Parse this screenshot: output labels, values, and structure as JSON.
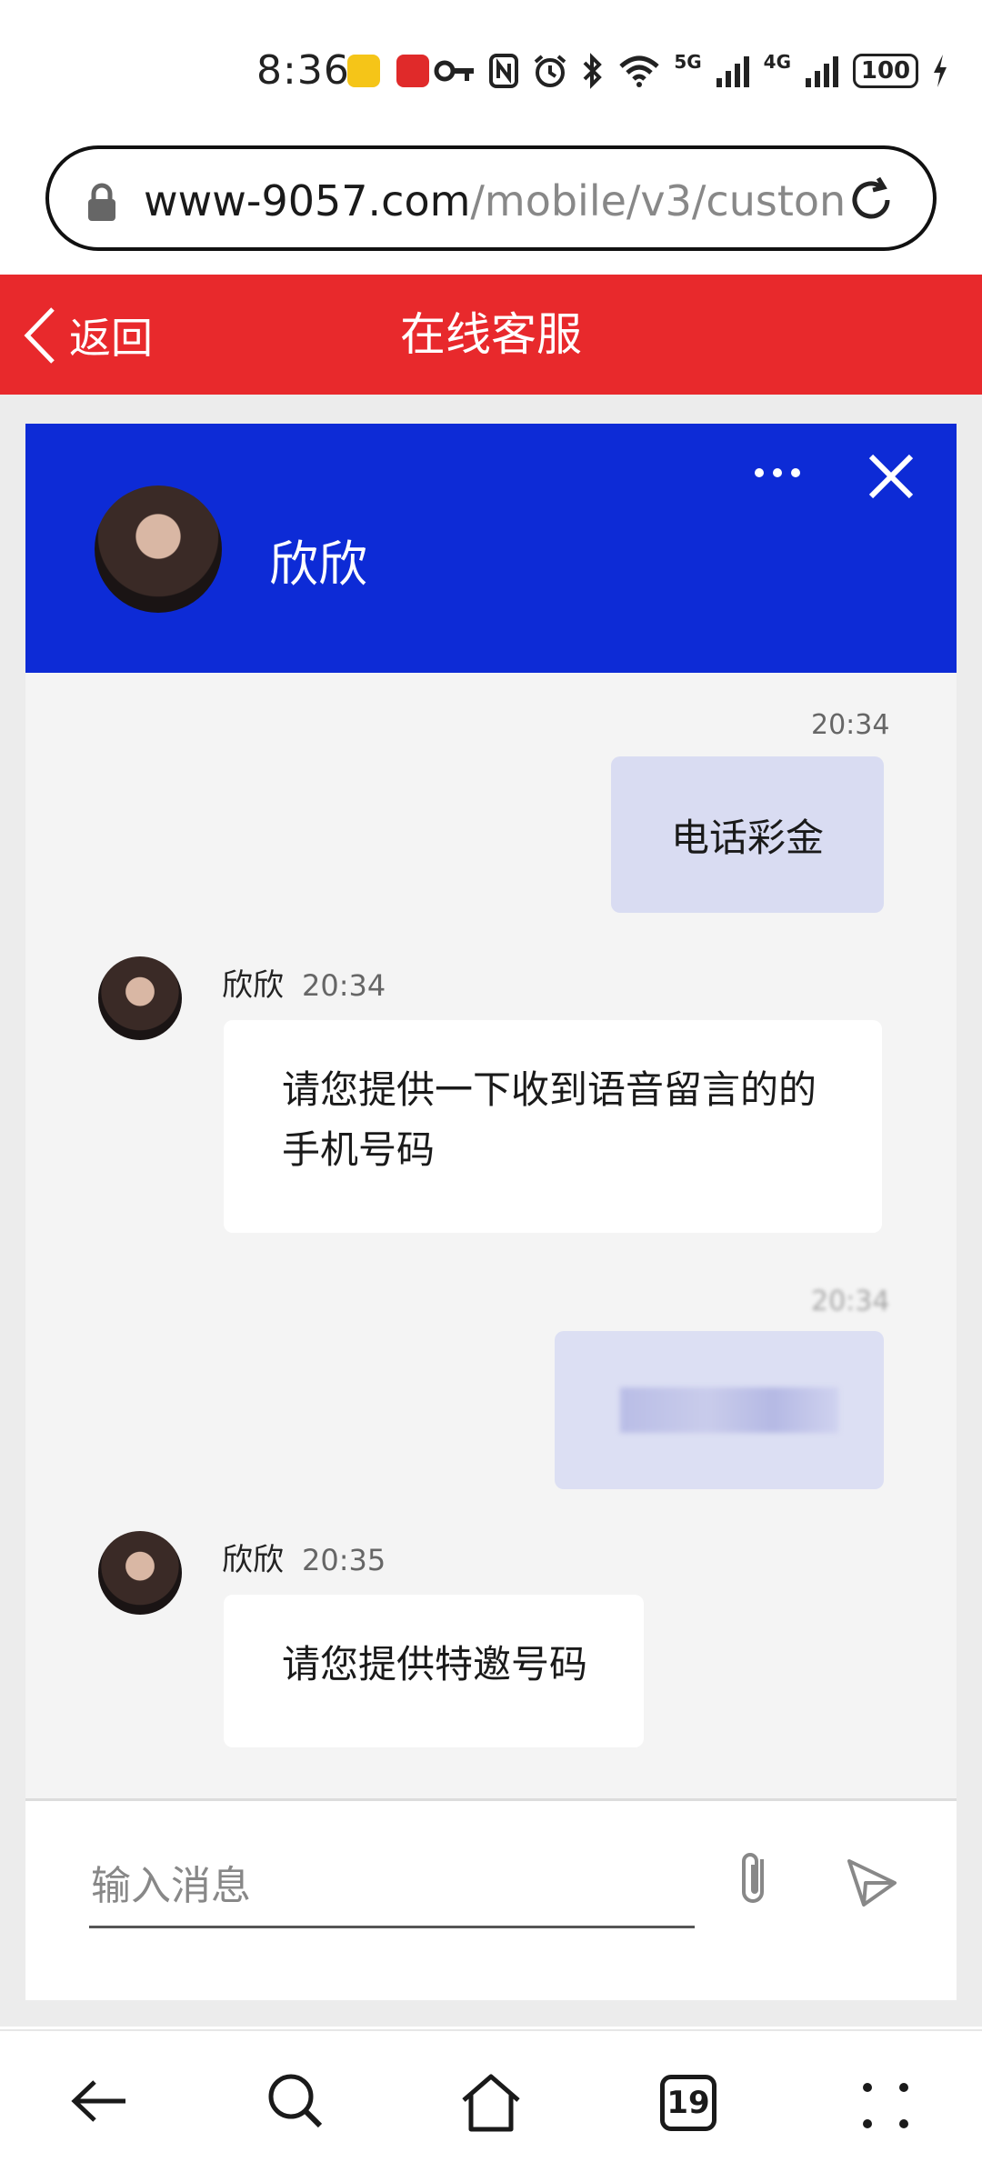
{
  "status_bar": {
    "time": "8:36",
    "network_5g": "5G",
    "network_4g": "4G",
    "battery": "100",
    "icons": [
      "weibo-app-icon",
      "leqi-app-icon",
      "key-icon",
      "nfc-icon",
      "alarm-icon",
      "bluetooth-icon",
      "wifi-icon",
      "signal-icon",
      "charging-icon"
    ]
  },
  "browser": {
    "url_domain": "www-9057.com",
    "url_path": "/mobile/v3/custon"
  },
  "header": {
    "back_label": "返回",
    "title": "在线客服"
  },
  "chat": {
    "agent_name": "欣欣",
    "head_color": "#0d2bd6",
    "messages": [
      {
        "from": "me",
        "time": "20:34",
        "text": "电话彩金"
      },
      {
        "from": "agent",
        "sender": "欣欣",
        "time": "20:34",
        "text": "请您提供一下收到语音留言的的手机号码"
      },
      {
        "from": "me",
        "time": "20:34",
        "text": ""
      },
      {
        "from": "agent",
        "sender": "欣欣",
        "time": "20:35",
        "text": "请您提供特邀号码"
      }
    ]
  },
  "composer": {
    "placeholder": "输入消息"
  },
  "nav": {
    "tab_count": "19"
  },
  "colors": {
    "brand_red": "#e8292c",
    "my_bubble": "#d9dcf2"
  }
}
